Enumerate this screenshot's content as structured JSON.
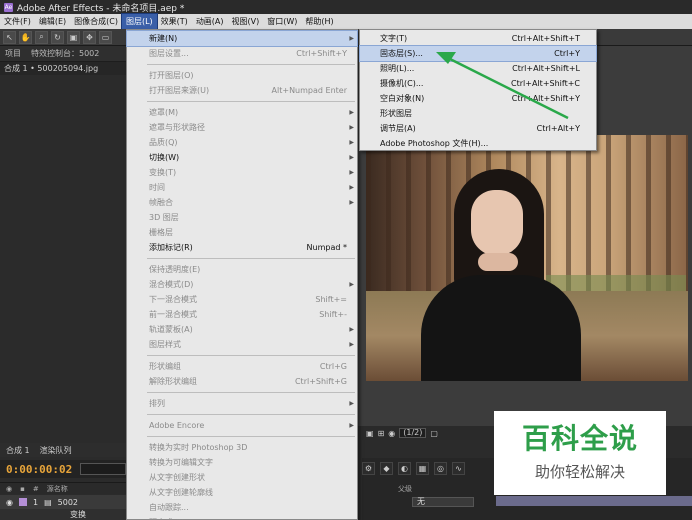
{
  "window": {
    "title": "Adobe After Effects - 未命名项目.aep *",
    "logo": "Ae"
  },
  "menubar": [
    {
      "label": "文件(F)"
    },
    {
      "label": "编辑(E)"
    },
    {
      "label": "图像合成(C)"
    },
    {
      "label": "图层(L)",
      "active": true
    },
    {
      "label": "效果(T)"
    },
    {
      "label": "动画(A)"
    },
    {
      "label": "视图(V)"
    },
    {
      "label": "窗口(W)"
    },
    {
      "label": "帮助(H)"
    }
  ],
  "toolbar_icons": [
    "arrow-icon",
    "hand-icon",
    "zoom-icon",
    "rotate-icon",
    "camera-icon",
    "pan-icon",
    "rect-icon"
  ],
  "panel": {
    "tab_project": "项目",
    "tab_effects": "特效控制台：5002",
    "comp_label": "合成 1 • 500205094.jpg"
  },
  "viewer_bar": {
    "res": "(1/2)"
  },
  "timeline": {
    "tab_comp": "合成 1",
    "tab_render": "渲染队列",
    "timecode": "0:00:00:02",
    "col_source": "源名称",
    "col_mode": "父级",
    "layer_num": "1",
    "layer_name": "5002",
    "sub_row": "变换",
    "mode_value": "无"
  },
  "layer_menu": [
    {
      "label": "新建(N)",
      "arrow": true,
      "highlight": true
    },
    {
      "label": "图层设置...",
      "shortcut": "Ctrl+Shift+Y",
      "disabled": true
    },
    {
      "sep": true
    },
    {
      "label": "打开图层(O)",
      "disabled": true
    },
    {
      "label": "打开图层来源(U)",
      "shortcut": "Alt+Numpad Enter",
      "disabled": true
    },
    {
      "sep": true
    },
    {
      "label": "遮罩(M)",
      "arrow": true,
      "disabled": true
    },
    {
      "label": "遮罩与形状路径",
      "arrow": true,
      "disabled": true
    },
    {
      "label": "品质(Q)",
      "arrow": true,
      "disabled": true
    },
    {
      "label": "切换(W)",
      "arrow": true
    },
    {
      "label": "变换(T)",
      "arrow": true,
      "disabled": true
    },
    {
      "label": "时间",
      "arrow": true,
      "disabled": true
    },
    {
      "label": "帧融合",
      "arrow": true,
      "disabled": true
    },
    {
      "label": "3D 图层",
      "disabled": true
    },
    {
      "label": "栅格层",
      "disabled": true
    },
    {
      "label": "添加标记(R)",
      "shortcut": "Numpad *"
    },
    {
      "sep": true
    },
    {
      "label": "保持透明度(E)",
      "disabled": true
    },
    {
      "label": "混合模式(D)",
      "arrow": true,
      "disabled": true
    },
    {
      "label": "下一混合模式",
      "shortcut": "Shift+=",
      "disabled": true
    },
    {
      "label": "前一混合模式",
      "shortcut": "Shift+-",
      "disabled": true
    },
    {
      "label": "轨道蒙板(A)",
      "arrow": true,
      "disabled": true
    },
    {
      "label": "图层样式",
      "arrow": true,
      "disabled": true
    },
    {
      "sep": true
    },
    {
      "label": "形状编组",
      "shortcut": "Ctrl+G",
      "disabled": true
    },
    {
      "label": "解除形状编组",
      "shortcut": "Ctrl+Shift+G",
      "disabled": true
    },
    {
      "sep": true
    },
    {
      "label": "排列",
      "arrow": true,
      "disabled": true
    },
    {
      "sep": true
    },
    {
      "label": "Adobe Encore",
      "arrow": true,
      "disabled": true
    },
    {
      "sep": true
    },
    {
      "label": "转换为实时 Photoshop 3D",
      "disabled": true
    },
    {
      "label": "转换为可编辑文字",
      "disabled": true
    },
    {
      "label": "从文字创建形状",
      "disabled": true
    },
    {
      "label": "从文字创建轮廓线",
      "disabled": true
    },
    {
      "label": "自动跟踪...",
      "disabled": true
    },
    {
      "label": "预合成(P)...",
      "shortcut": "Ctrl+Shift+C",
      "disabled": true
    }
  ],
  "new_submenu": [
    {
      "label": "文字(T)",
      "shortcut": "Ctrl+Alt+Shift+T"
    },
    {
      "label": "固态层(S)...",
      "shortcut": "Ctrl+Y",
      "highlight": true
    },
    {
      "label": "照明(L)...",
      "shortcut": "Ctrl+Alt+Shift+L"
    },
    {
      "label": "摄像机(C)...",
      "shortcut": "Ctrl+Alt+Shift+C"
    },
    {
      "label": "空白对象(N)",
      "shortcut": "Ctrl+Alt+Shift+Y"
    },
    {
      "label": "形状图层"
    },
    {
      "label": "调节层(A)",
      "shortcut": "Ctrl+Alt+Y"
    },
    {
      "label": "Adobe Photoshop 文件(H)..."
    }
  ],
  "watermark": {
    "title": "百科全说",
    "subtitle": "助你轻松解决"
  },
  "colors": {
    "annotation_arrow": "#2aa84a",
    "menu_highlight": "#c3d3ec",
    "timecode": "#e8a53a"
  }
}
